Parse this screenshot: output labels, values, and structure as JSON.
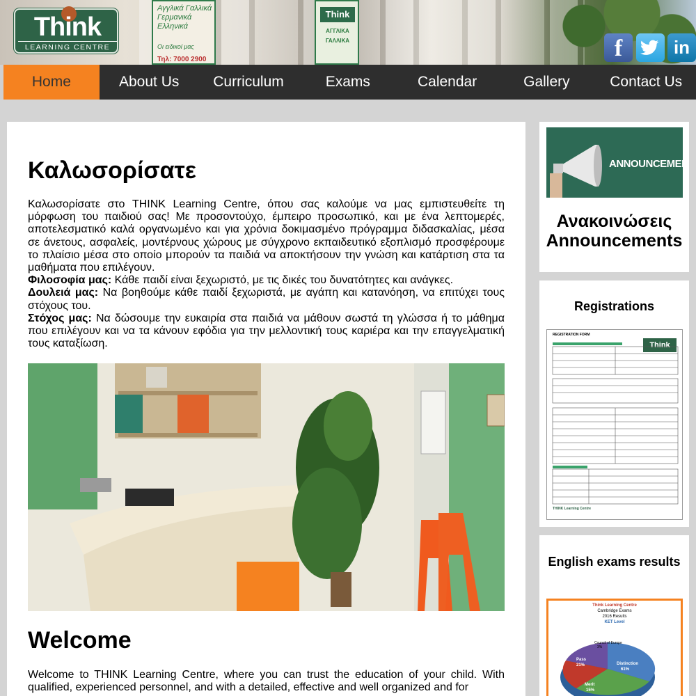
{
  "header": {
    "logo_title": "Think",
    "logo_subtitle": "LEARNING CENTRE",
    "banner_text": "Αγγλικά Γαλλικά Γερμανικά Ελληνικά",
    "banner_tagline": "Οι ειδικοί μας",
    "banner_phone": "Τηλ: 7000 2900",
    "banner2_logo": "Think",
    "banner2_items": "ΑΓΓΛΙΚΑ ΓΑΛΛΙΚΑ",
    "social": {
      "facebook": "f",
      "twitter": "t",
      "linkedin": "in"
    }
  },
  "nav": {
    "items": [
      "Home",
      "About Us",
      "Curriculum",
      "Exams",
      "Calendar",
      "Gallery",
      "Contact Us"
    ],
    "active": "Home"
  },
  "main": {
    "title_gr": "Καλωσορίσατε",
    "intro_gr": "Καλωσορίσατε στο THINK Learning Centre, όπου σας καλούμε να μας εμπιστευθείτε τη μόρφωση του παιδιού σας! Με προσοντούχο, έμπειρο προσωπικό, και με ένα λεπτομερές, αποτελεσματικό καλά οργανωμένο και για χρόνια δοκιμασμένο πρόγραμμα διδασκαλίας, μέσα σε άνετους, ασφαλείς, μοντέρνους χώρους με σύγχρονο εκπαιδευτικό εξοπλισμό προσφέρουμε το πλαίσιο μέσα στο οποίο μπορούν τα παιδιά να αποκτήσουν την γνώση και κατάρτιση στα τα μαθήματα που επιλέγουν.",
    "philosophy_label": "Φιλοσοφία μας:",
    "philosophy_text": " Κάθε παιδί είναι ξεχωριστό, με τις δικές του δυνατότητες και ανάγκες.",
    "work_label": "Δουλειά μας:",
    "work_text": " Να βοηθούμε κάθε παιδί ξεχωριστά, με αγάπη και κατανόηση, να επιτύχει τους στόχους του.",
    "goal_label": "Στόχος μας:",
    "goal_text": " Να δώσουμε την ευκαιρία στα παιδιά να μάθουν σωστά τη γλώσσα ή το μάθημα που επιλέγουν και να τα κάνουν εφόδια για την μελλοντική τους καριέρα και την επαγγελματική τους καταξίωση.",
    "title_en": "Welcome",
    "intro_en": "Welcome to THINK Learning Centre, where you can trust the education of your child. With qualified, experienced personnel, and with a detailed, effective and well organized and for"
  },
  "sidebar": {
    "announcements_image_text": "ANNOUNCEMENTS",
    "announcements_gr": "Ανακοινώσεις",
    "announcements_en": "Announcements",
    "registrations_title": "Registrations",
    "registration_form_heading": "REGISTRATION FORM",
    "registration_form_logo": "Think",
    "registration_form_footer": "THINK Learning Centre",
    "results_title": "English exams results",
    "results_lines": [
      "Think Learning Centre",
      "Cambridge Exams",
      "2016 Results",
      "KET Level"
    ],
    "results_chart_labels": [
      "Council of Europe",
      "Pass",
      "Distinction",
      "Merit"
    ],
    "results_chart_values": [
      "3%",
      "21%",
      "61%",
      "15%"
    ]
  },
  "colors": {
    "nav_bg": "#2e2e2e",
    "nav_active": "#f58220",
    "page_bg": "#d4d4d4",
    "logo_green": "#2e6347"
  }
}
